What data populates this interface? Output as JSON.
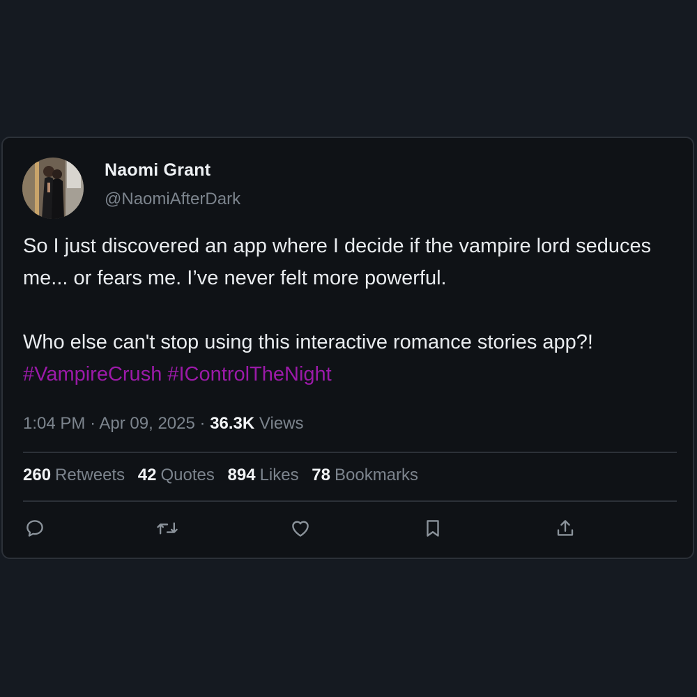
{
  "author": {
    "name": "Naomi Grant",
    "handle": "@NaomiAfterDark",
    "avatar_icon": "profile-photo-couple"
  },
  "post": {
    "line1": "So I just discovered an app where I decide if the vampire lord seduces me... or fears me. I’ve never felt more powerful.",
    "line2": "Who else can't stop using this interactive romance stories app?!",
    "hashtags": "#VampireCrush #IControlTheNight"
  },
  "meta": {
    "time": "1:04 PM",
    "separator1": "·",
    "date": "Apr 09, 2025",
    "separator2": "·",
    "views_count": "36.3K",
    "views_label": "Views"
  },
  "stats": [
    {
      "count": "260",
      "label": "Retweets"
    },
    {
      "count": "42",
      "label": "Quotes"
    },
    {
      "count": "894",
      "label": "Likes"
    },
    {
      "count": "78",
      "label": "Bookmarks"
    }
  ],
  "actions": [
    {
      "icon": "reply-icon"
    },
    {
      "icon": "retweet-icon"
    },
    {
      "icon": "like-icon"
    },
    {
      "icon": "bookmark-icon"
    },
    {
      "icon": "share-icon"
    }
  ],
  "colors": {
    "background": "#151a21",
    "card": "#0f1216",
    "hashtag": "#9b1aa8",
    "secondary_text": "#7c848d"
  }
}
